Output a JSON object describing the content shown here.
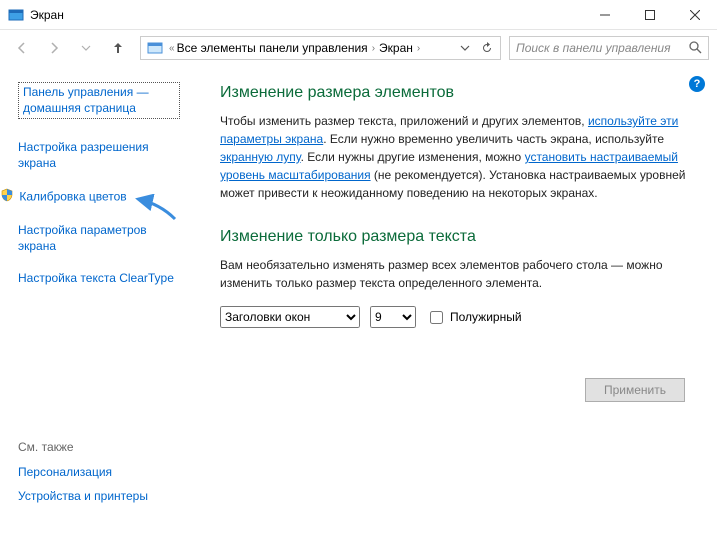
{
  "window": {
    "title": "Экран"
  },
  "breadcrumb": {
    "item1": "Все элементы панели управления",
    "item2": "Экран"
  },
  "search": {
    "placeholder": "Поиск в панели управления"
  },
  "sidebar": {
    "home": "Панель управления — домашняя страница",
    "links": {
      "resolution": "Настройка разрешения экрана",
      "calibration": "Калибровка цветов",
      "params": "Настройка параметров экрана",
      "cleartype": "Настройка текста ClearType"
    },
    "footer": {
      "heading": "См. также",
      "personalization": "Персонализация",
      "devices": "Устройства и принтеры"
    }
  },
  "main": {
    "h1": "Изменение размера элементов",
    "p1a": "Чтобы изменить размер текста, приложений и других элементов, ",
    "p1link1": "используйте эти параметры экрана",
    "p1b": ". Если нужно временно увеличить часть экрана, используйте ",
    "p1link2": "экранную лупу",
    "p1c": ". Если нужны другие изменения, можно ",
    "p1link3": "установить настраиваемый уровень масштабирования",
    "p1d": " (не рекомендуется). Установка настраиваемых уровней может привести к неожиданному поведению на некоторых экранах.",
    "h2": "Изменение только размера текста",
    "p2": "Вам необязательно изменять размер всех элементов рабочего стола — можно изменить только размер текста определенного элемента.",
    "select_item": "Заголовки окон",
    "select_size": "9",
    "bold_label": "Полужирный",
    "apply": "Применить"
  }
}
